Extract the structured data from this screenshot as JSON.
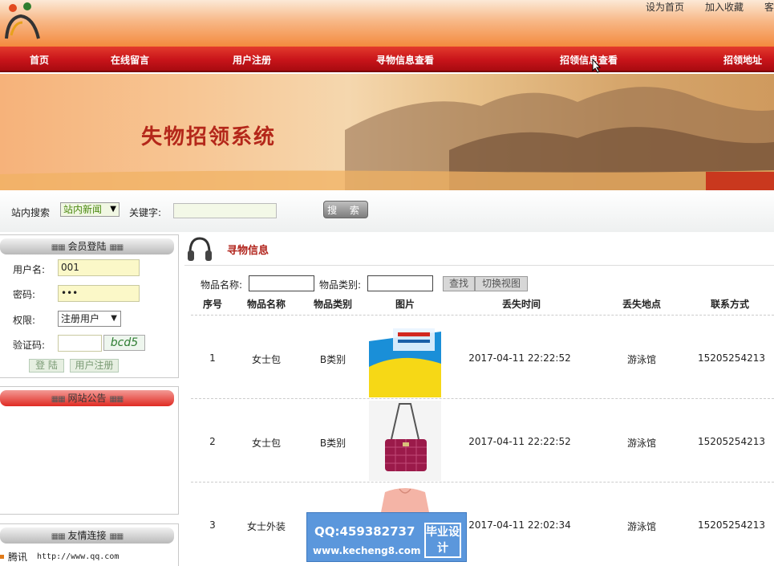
{
  "top_links": [
    "设为首页",
    "加入收藏",
    "客"
  ],
  "nav": [
    "首页",
    "在线留言",
    "用户注册",
    "寻物信息查看",
    "招领信息查看",
    "招领地址"
  ],
  "banner_title": "失物招领系统",
  "search": {
    "site_search_label": "站内搜索",
    "category_value": "站内新闻",
    "keyword_label": "关键字:",
    "button": "搜 索"
  },
  "login": {
    "title": "会员登陆",
    "username_label": "用户名:",
    "username_value": "001",
    "password_label": "密码:",
    "password_value": "•••",
    "role_label": "权限:",
    "role_value": "注册用户",
    "captcha_label": "验证码:",
    "captcha_text": "bcd5",
    "login_button": "登 陆",
    "register_button": "用户注册"
  },
  "notice": {
    "title": "网站公告"
  },
  "friends": {
    "title": "友情连接",
    "items": [
      {
        "name": "腾讯",
        "url": "http://www.qq.com"
      }
    ]
  },
  "main": {
    "title": "寻物信息",
    "filter": {
      "name_label": "物品名称:",
      "category_label": "物品类别:",
      "search_button": "查找",
      "switch_button": "切换视图"
    },
    "columns": [
      "序号",
      "物品名称",
      "物品类别",
      "图片",
      "丢失时间",
      "丢失地点",
      "联系方式"
    ],
    "rows": [
      {
        "no": "1",
        "name": "女士包",
        "category": "B类别",
        "image": "book-cover",
        "time": "2017-04-11 22:22:52",
        "place": "游泳馆",
        "contact": "15205254213"
      },
      {
        "no": "2",
        "name": "女士包",
        "category": "B类别",
        "image": "red-handbag",
        "time": "2017-04-11 22:22:52",
        "place": "游泳馆",
        "contact": "15205254213"
      },
      {
        "no": "3",
        "name": "女士外装",
        "category": "",
        "image": "pink-blouse",
        "time": "2017-04-11 22:02:34",
        "place": "游泳馆",
        "contact": "15205254213"
      }
    ]
  },
  "watermark": {
    "qq": "QQ:459382737",
    "site": "www.kecheng8.com",
    "tag": "毕业设计"
  }
}
